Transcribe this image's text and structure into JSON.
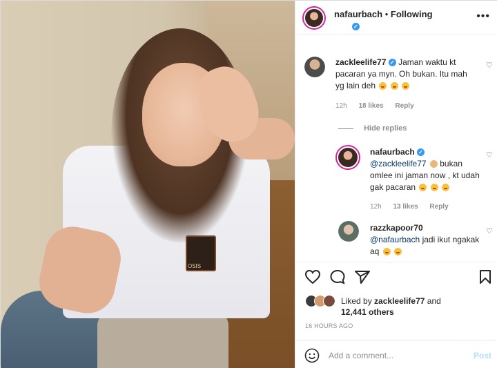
{
  "post": {
    "username": "nafaurbach",
    "follow_status": "Following",
    "menu_icon": "more-horizontal-icon"
  },
  "comments": {
    "first": {
      "username": "zackleelife77",
      "text": "Jaman waktu kt pacaran ya myn. Oh bukan. Itu mah yg lain deh",
      "emojis": [
        "rolling-laughing",
        "rolling-laughing",
        "rolling-laughing"
      ],
      "time": "12h",
      "likes": "18 likes",
      "reply": "Reply"
    },
    "hide_replies": "Hide replies",
    "reply1": {
      "username": "nafaurbach",
      "mention": "@zackleelife77",
      "text_a": "bukan",
      "text_b": "omlee ini jaman now , kt udah gak pacaran",
      "emojis": [
        "person-shrug",
        "joy",
        "joy",
        "joy"
      ],
      "time": "12h",
      "likes": "13 likes",
      "reply": "Reply"
    },
    "reply2": {
      "username": "razzkapoor70",
      "mention": "@nafaurbach",
      "text": "jadi ikut ngakak aq",
      "emojis": [
        "joy",
        "joy"
      ]
    }
  },
  "likes": {
    "prefix": "Liked by",
    "user": "zackleelife77",
    "and": "and",
    "others": "12,441 others"
  },
  "timestamp": "16 HOURS AGO",
  "add_comment": {
    "placeholder": "Add a comment...",
    "post_label": "Post"
  },
  "photo": {
    "badge_text": "OSIS"
  },
  "colors": {
    "link": "#00376b",
    "verified": "#3897f0",
    "muted": "#8e8e8e",
    "post_button": "#b2dffc"
  }
}
